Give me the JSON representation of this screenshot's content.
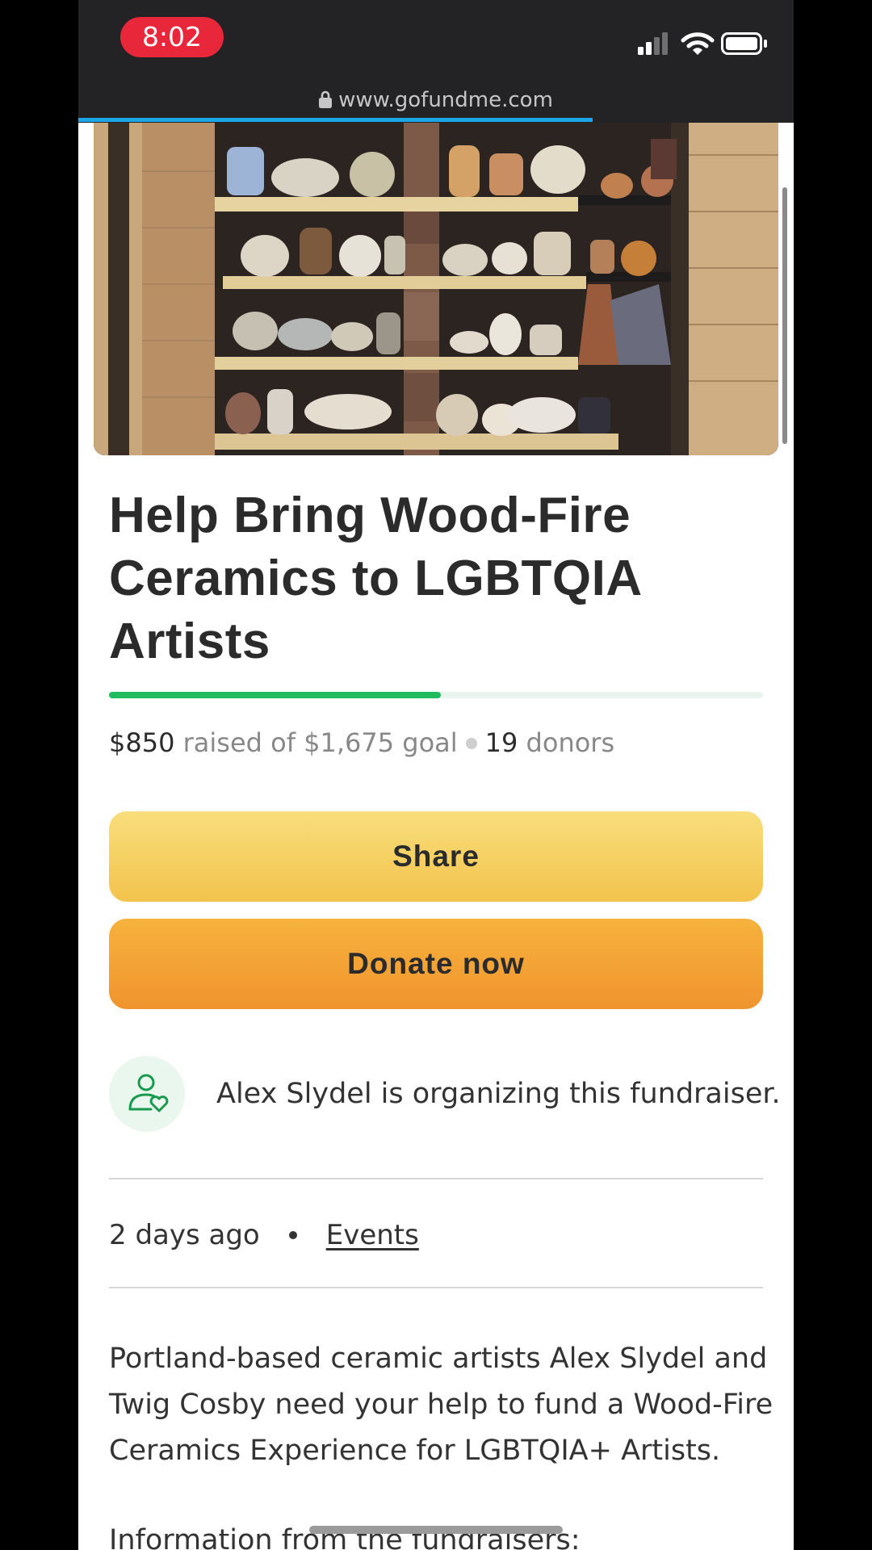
{
  "status_bar": {
    "time": "8:02"
  },
  "browser": {
    "url": "www.gofundme.com"
  },
  "campaign": {
    "title": "Help Bring Wood-Fire Ceramics to LGBTQIA Artists",
    "progress_fraction": 0.507,
    "raised": "$850",
    "raised_text": "raised of $1,675 goal",
    "donor_count": "19",
    "donors_label": "donors"
  },
  "actions": {
    "share_label": "Share",
    "donate_label": "Donate now"
  },
  "organizer": {
    "text": "Alex Slydel is organizing this fundraiser."
  },
  "meta": {
    "posted": "2 days ago",
    "category": "Events"
  },
  "description": {
    "paragraph": "Portland-based ceramic artists Alex Slydel and Twig Cosby need your help to fund a Wood-Fire Ceramics Experience for LGBTQIA+ Artists.",
    "section_heading": "Information from the fundraisers:"
  },
  "colors": {
    "progress_green": "#1fbb5c",
    "share_yellow": "#f5cf60",
    "donate_orange": "#f3a535",
    "time_pill_red": "#e8273a"
  },
  "icons": [
    "lock-icon",
    "signal-icon",
    "wifi-icon",
    "battery-icon",
    "organizer-heart-icon"
  ]
}
